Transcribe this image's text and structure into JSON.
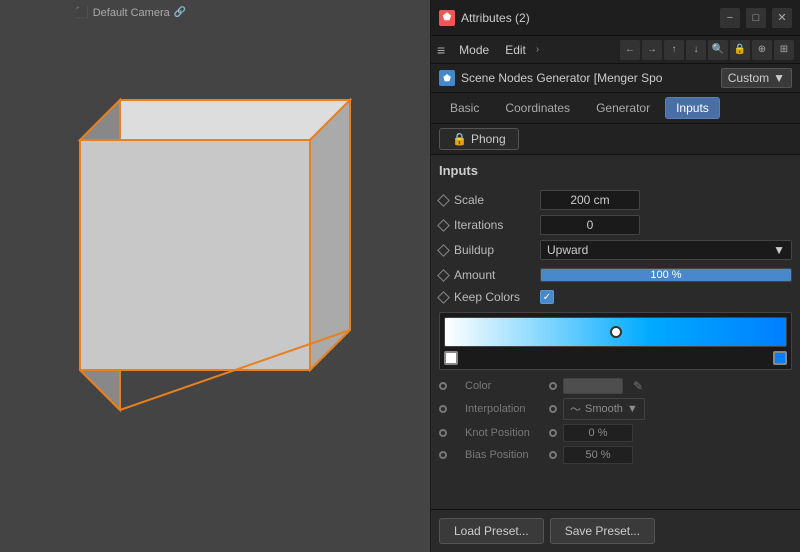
{
  "viewport": {
    "camera_label": "Default Camera",
    "camera_icon": "📷"
  },
  "panel": {
    "title": "Attributes (2)",
    "title_icon": "⬟",
    "controls": {
      "minimize": "−",
      "maximize": "□",
      "close": "✕"
    }
  },
  "menubar": {
    "mode_label": "Mode",
    "edit_label": "Edit",
    "arrow": ">",
    "nav_buttons": [
      "←",
      "→",
      "↑",
      "↓",
      "🔍",
      "🔒",
      "⊕",
      "⊞"
    ]
  },
  "generator": {
    "icon": "⬟",
    "name": "Scene Nodes Generator [Menger Spo",
    "preset": "Custom",
    "dropdown_arrow": "▼"
  },
  "tabs": {
    "items": [
      {
        "label": "Basic",
        "active": false
      },
      {
        "label": "Coordinates",
        "active": false
      },
      {
        "label": "Generator",
        "active": false
      },
      {
        "label": "Inputs",
        "active": true
      }
    ]
  },
  "phong": {
    "label": "🔒 Phong"
  },
  "inputs_section": {
    "title": "Inputs",
    "fields": {
      "scale": {
        "label": "Scale",
        "value": "200 cm"
      },
      "iterations": {
        "label": "Iterations",
        "value": "0"
      },
      "buildup": {
        "label": "Buildup",
        "value": "Upward"
      },
      "amount": {
        "label": "Amount",
        "value": "100 %",
        "fill_percent": "100"
      },
      "keep_colors": {
        "label": "Keep Colors",
        "checked": true
      }
    }
  },
  "gradient": {
    "color_label": "Color",
    "interpolation_label": "Interpolation",
    "interpolation_value": "Smooth",
    "knot_position_label": "Knot Position",
    "knot_position_value": "0 %",
    "bias_position_label": "Bias Position",
    "bias_position_value": "50 %"
  },
  "footer": {
    "load_preset": "Load Preset...",
    "save_preset": "Save Preset..."
  }
}
